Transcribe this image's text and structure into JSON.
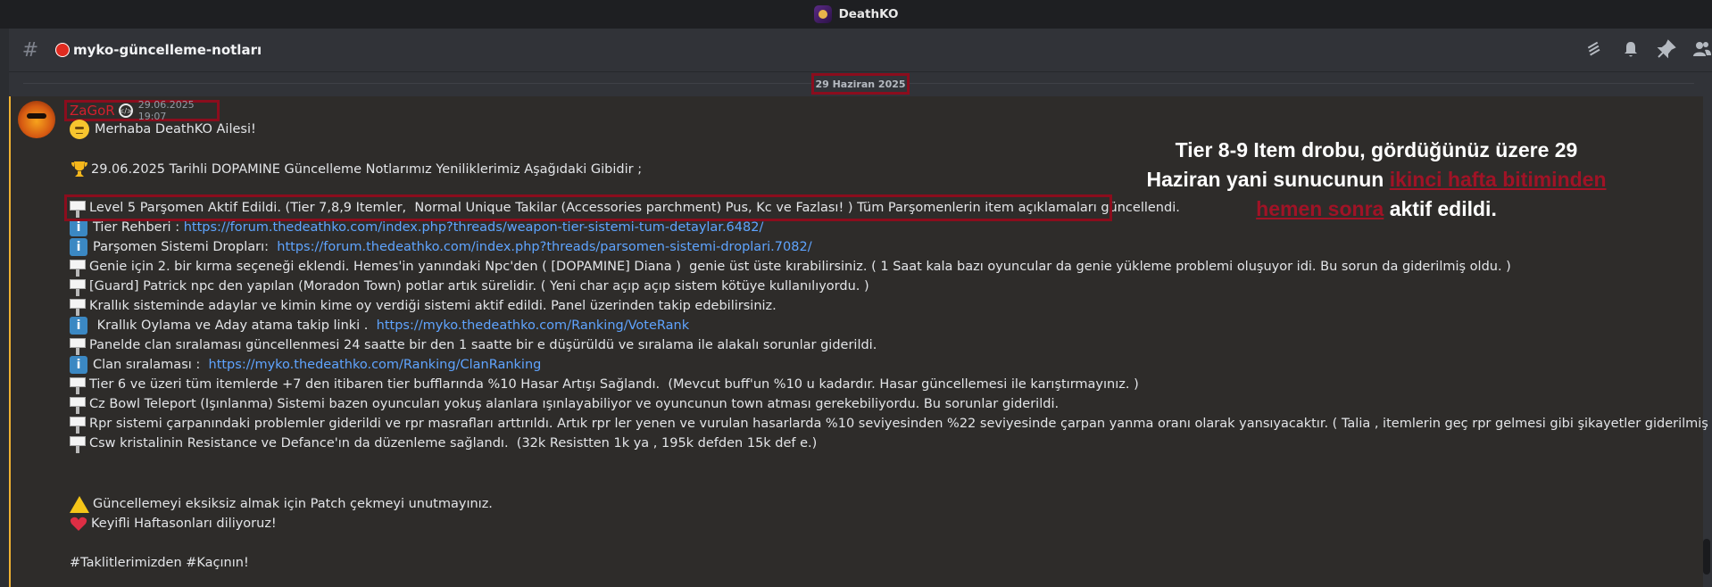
{
  "window": {
    "title": "DeathKO"
  },
  "channel": {
    "name": "myko-güncelleme-notları"
  },
  "header_icons": [
    "threads-icon",
    "bell-icon",
    "pin-icon",
    "members-icon"
  ],
  "date_divider": "29 Haziran 2025",
  "message": {
    "author": "ZaGoR",
    "timestamp": "29.06.2025 19:07",
    "greeting": "Merhaba DeathKO Ailesi!",
    "intro": "29.06.2025 Tarihli DOPAMINE Güncelleme Notlarımız Yeniliklerimiz Aşağıdaki Gibidir ;",
    "items": [
      {
        "icon": "notice",
        "text": "Level 5 Parşomen Aktif Edildi. (Tier 7,8,9 Itemler,  Normal Unique Takilar (Accessories parchment) Pus, Kc ve Fazlası! ) Tüm Parşomenlerin item açıklamaları güncellendi."
      },
      {
        "icon": "info",
        "text": "Tier Rehberi : ",
        "link": "https://forum.thedeathko.com/index.php?threads/weapon-tier-sistemi-tum-detaylar.6482/"
      },
      {
        "icon": "info",
        "text": "Parşomen Sistemi Dropları:  ",
        "link": "https://forum.thedeathko.com/index.php?threads/parsomen-sistemi-droplari.7082/"
      },
      {
        "icon": "notice",
        "text": "Genie için 2. bir kırma seçeneği eklendi. Hemes'in yanındaki Npc'den ( [DOPAMINE] Diana )  genie üst üste kırabilirsiniz. ( 1 Saat kala bazı oyuncular da genie yükleme problemi oluşuyor idi. Bu sorun da giderilmiş oldu. )"
      },
      {
        "icon": "notice",
        "text": "[Guard] Patrick npc den yapılan (Moradon Town) potlar artık sürelidir. ( Yeni char açıp açıp sistem kötüye kullanılıyordu. )"
      },
      {
        "icon": "notice",
        "text": "Krallık sisteminde adaylar ve kimin kime oy verdiği sistemi aktif edildi. Panel üzerinden takip edebilirsiniz."
      },
      {
        "icon": "info",
        "text": " Krallık Oylama ve Aday atama takip linki .  ",
        "link": "https://myko.thedeathko.com/Ranking/VoteRank"
      },
      {
        "icon": "notice",
        "text": "Panelde clan sıralaması güncellenmesi 24 saatte bir den 1 saatte bir e düşürüldü ve sıralama ile alakalı sorunlar giderildi."
      },
      {
        "icon": "info",
        "text": "Clan sıralaması :  ",
        "link": "https://myko.thedeathko.com/Ranking/ClanRanking"
      },
      {
        "icon": "notice",
        "text": "Tier 6 ve üzeri tüm itemlerde +7 den itibaren tier bufflarında %10 Hasar Artışı Sağlandı.  (Mevcut buff'un %10 u kadardır. Hasar güncellemesi ile karıştırmayınız. )"
      },
      {
        "icon": "notice",
        "text": "Cz Bowl Teleport (Işınlanma) Sistemi bazen oyuncuları yokuş alanlara ışınlayabiliyor ve oyuncunun town atması gerekebiliyordu. Bu sorunlar giderildi."
      },
      {
        "icon": "notice",
        "text": "Rpr sistemi çarpanındaki problemler giderildi ve rpr masrafları arttırıldı. Artık rpr ler yenen ve vurulan hasarlarda %10 seviyesinden %22 seviyesinde çarpan yanma oranı olarak yansıyacaktır. ( Talia , itemlerin geç rpr gelmesi gibi şikayetler giderilmiş oldu. )"
      },
      {
        "icon": "notice",
        "text": "Csw kristalinin Resistance ve Defance'ın da düzenleme sağlandı.  (32k Resistten 1k ya , 195k defden 15k def e.)"
      }
    ],
    "warning": "Güncellemeyi eksiksiz almak için Patch çekmeyi unutmayınız.",
    "farewell": "Keyifli Haftasonları diliyoruz!",
    "hashtags": "#Taklitlerimizden #Kaçının!"
  },
  "annotation": {
    "line1": "Tier 8-9 Item drobu, gördüğünüz üzere 29",
    "line2a": "Haziran yani sunucunun ",
    "line2b": "ikinci hafta bitiminden",
    "line3a": "hemen sonra",
    "line3b": " aktif edildi."
  },
  "colors": {
    "author": "#d41f2d",
    "link": "#5fa4ff",
    "highlight_box": "#8b0d1d",
    "background": "#313338"
  }
}
